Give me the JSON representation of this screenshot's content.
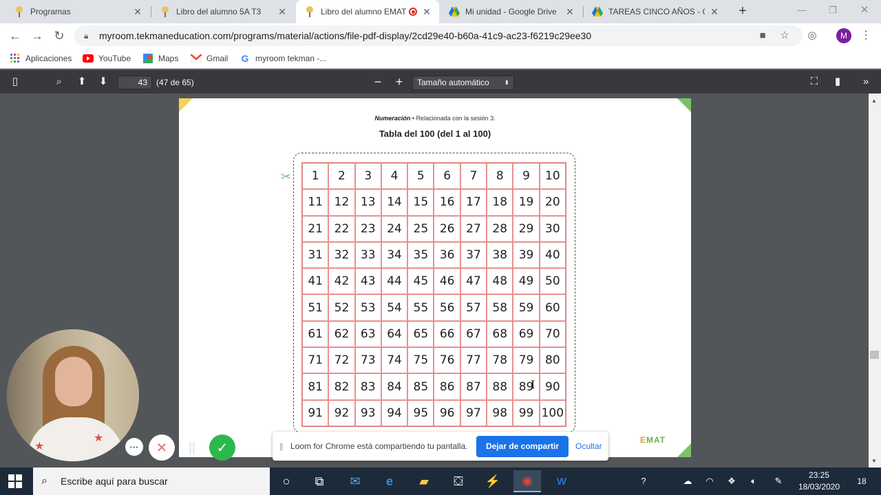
{
  "tabs": [
    {
      "title": "Programas",
      "icon": "tekman-icon"
    },
    {
      "title": "Libro del alumno 5A T3",
      "icon": "tekman-icon"
    },
    {
      "title": "Libro del alumno EMAT",
      "icon": "tekman-icon",
      "active": true,
      "recording": true
    },
    {
      "title": "Mi unidad - Google Drive",
      "icon": "google-drive-icon"
    },
    {
      "title": "TAREAS CINCO AÑOS - Go",
      "icon": "google-drive-icon"
    }
  ],
  "omnibox": {
    "url": "myroom.tekmaneducation.com/programs/material/actions/file-pdf-display/2cd29e40-b60a-41c9-ac23-f6219c29ee30"
  },
  "profile_initial": "M",
  "bookmarks": [
    {
      "label": "Aplicaciones",
      "icon": "apps-grid-icon"
    },
    {
      "label": "YouTube",
      "icon": "youtube-icon"
    },
    {
      "label": "Maps",
      "icon": "maps-icon"
    },
    {
      "label": "Gmail",
      "icon": "gmail-icon"
    },
    {
      "label": "myroom tekman -...",
      "icon": "google-icon"
    }
  ],
  "pdf_toolbar": {
    "page_number": "43",
    "page_count": "(47 de 65)",
    "zoom": "Tamaño automático"
  },
  "pdf_page": {
    "section": "Numeración",
    "bullet": "•",
    "related": "Relacionada con la sesión 3.",
    "title": "Tabla del 100 (del 1 al 100)",
    "brand": "EMAT",
    "numbers": [
      "1",
      "2",
      "3",
      "4",
      "5",
      "6",
      "7",
      "8",
      "9",
      "10",
      "11",
      "12",
      "13",
      "14",
      "15",
      "16",
      "17",
      "18",
      "19",
      "20",
      "21",
      "22",
      "23",
      "24",
      "25",
      "26",
      "27",
      "28",
      "29",
      "30",
      "31",
      "32",
      "33",
      "34",
      "35",
      "36",
      "37",
      "38",
      "39",
      "40",
      "41",
      "42",
      "43",
      "44",
      "45",
      "46",
      "47",
      "48",
      "49",
      "50",
      "51",
      "52",
      "53",
      "54",
      "55",
      "56",
      "57",
      "58",
      "59",
      "60",
      "61",
      "62",
      "63",
      "64",
      "65",
      "66",
      "67",
      "68",
      "69",
      "70",
      "71",
      "72",
      "73",
      "74",
      "75",
      "76",
      "77",
      "78",
      "79",
      "80",
      "81",
      "82",
      "83",
      "84",
      "85",
      "86",
      "87",
      "88",
      "89",
      "90",
      "91",
      "92",
      "93",
      "94",
      "95",
      "96",
      "97",
      "98",
      "99",
      "100"
    ]
  },
  "loom": {
    "message": "Loom for Chrome está compartiendo tu pantalla.",
    "stop_label": "Dejar de compartir",
    "hide_label": "Ocultar"
  },
  "taskbar": {
    "search_placeholder": "Escribe aquí para buscar",
    "time": "23:25",
    "date": "18/03/2020",
    "notifications": "18"
  },
  "colors": {
    "grid_line": "#e89090",
    "loom_button": "#1a73e8",
    "record_done": "#2db84c",
    "pdf_toolbar": "#38383d"
  }
}
